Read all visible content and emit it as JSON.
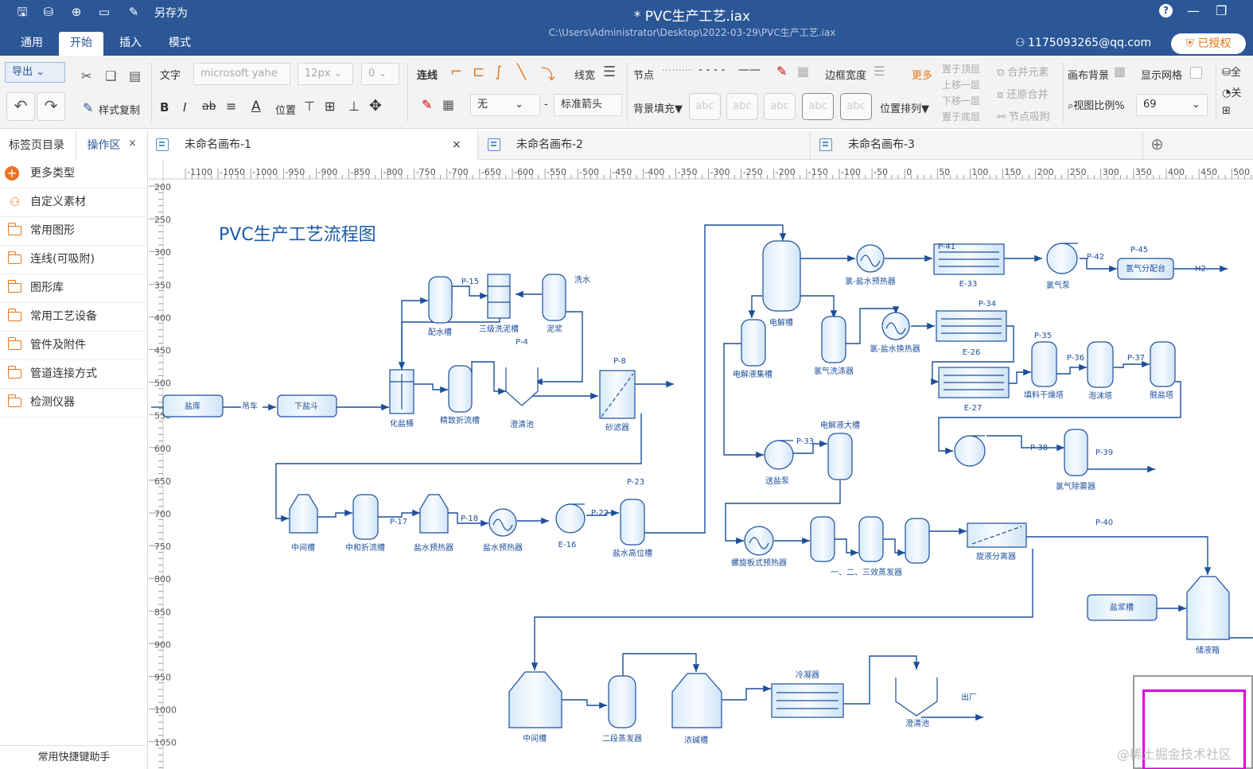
{
  "app": {
    "save_as": "另存为",
    "doc_title": "* PVC生产工艺.iax",
    "doc_path": "C:\\Users\\Administrator\\Desktop\\2022-03-29\\PVC生产工艺.iax",
    "account": "1175093265@qq.com",
    "license": "已授权"
  },
  "menu": [
    "通用",
    "开始",
    "插入",
    "模式"
  ],
  "toolbar": {
    "export": "导出",
    "format_painter": "样式复制",
    "text": "文字",
    "font": "microsoft yahe",
    "font_size": "12px",
    "letter_spacing": "0",
    "position": "位置",
    "connector": "连线",
    "line_width": "线宽",
    "arrow_type": "无",
    "arrow_dash": "-",
    "arrow_style": "标准箭头",
    "node": "节点",
    "border_width": "边框宽度",
    "more": "更多",
    "bg_fill": "背景填充▼",
    "swatch": "abc",
    "to_top": "置于顶层",
    "up_layer": "上移一层",
    "down_layer": "下移一层",
    "to_bottom": "置于底层",
    "arrange": "位置排列▼",
    "merge": "合并元素",
    "unmerge": "还原合并",
    "node_snap": "节点吸附",
    "canvas_bg": "画布背景",
    "show_grid": "显示网格",
    "zoom_label": "视图比例%",
    "zoom": "69",
    "right1": "全",
    "right2": "关"
  },
  "sidebar": {
    "tab1": "标签页目录",
    "tab2": "操作区",
    "items": [
      "更多类型",
      "自定义素材",
      "常用图形",
      "连线(可吸附)",
      "图形库",
      "常用工艺设备",
      "管件及附件",
      "管道连接方式",
      "检测仪器"
    ],
    "helper": "常用快捷键助手"
  },
  "tabs": [
    "未命名画布-1",
    "未命名画布-2",
    "未命名画布-3"
  ],
  "ruler": {
    "h": [
      "-1100",
      "-1050",
      "-1000",
      "-950",
      "-900",
      "-850",
      "-800",
      "-750",
      "-700",
      "-650",
      "-600",
      "-550",
      "-500",
      "-450",
      "-400",
      "-350",
      "-300",
      "-250",
      "-200",
      "-150",
      "-100",
      "-50",
      "0",
      "50",
      "100",
      "150",
      "200",
      "250",
      "300",
      "350",
      "400",
      "450",
      "500"
    ],
    "v": [
      "200",
      "250",
      "300",
      "350",
      "400",
      "450",
      "500",
      "550",
      "600",
      "650",
      "700",
      "750",
      "800",
      "850",
      "900",
      "950",
      "1000",
      "1050"
    ]
  },
  "diagram": {
    "title": "PVC生产工艺流程图",
    "labels": [
      "盐库",
      "吊车",
      "下盐斗",
      "化盐桶",
      "精致折流槽",
      "澄清池",
      "砂滤器",
      "配水槽",
      "三级洗泥槽",
      "泥浆",
      "洗水",
      "P-15",
      "P-4",
      "P-8",
      "中间槽",
      "中和折流槽",
      "P-17",
      "盐水预热器",
      "P-18",
      "盐水预热器",
      "E-16",
      "P-22",
      "P-23",
      "盐水高位槽",
      "电解槽",
      "氯-盐水预热器",
      "P-41",
      "E-33",
      "氯气泵",
      "P-42",
      "P-45",
      "氢气分配台",
      "H2",
      "电解液集槽",
      "氯气洗涤器",
      "氯-盐水换热器",
      "P-34",
      "E-26",
      "P-35",
      "P-36",
      "P-37",
      "E-27",
      "填料干燥塔",
      "泡沫塔",
      "脱盐塔",
      "送盐泵",
      "P-33",
      "电解液大槽",
      "P-38",
      "P-39",
      "氯气除雾器",
      "螺旋板式预热器",
      "一、二、三效蒸发器",
      "旋液分离器",
      "P-40",
      "盐浆槽",
      "储液箱",
      "中间槽",
      "二段蒸发器",
      "浓碱槽",
      "冷凝器",
      "出厂",
      "澄清池"
    ]
  },
  "watermark": "@稀土掘金技术社区"
}
